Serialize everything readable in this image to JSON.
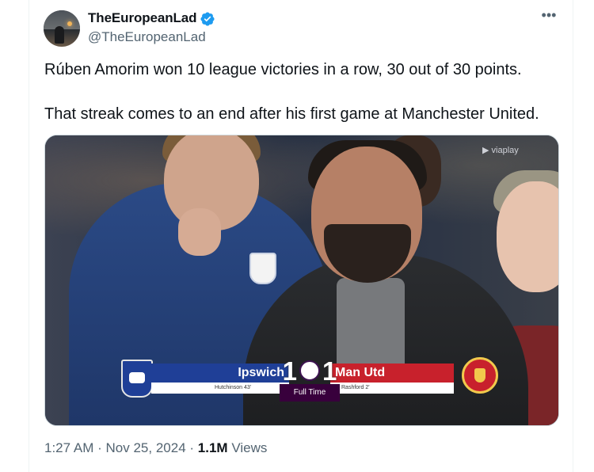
{
  "author": {
    "display_name": "TheEuropeanLad",
    "handle": "@TheEuropeanLad",
    "verified": true,
    "verified_color": "#1d9bf0"
  },
  "more_icon": "more-horizontal-icon",
  "tweet": {
    "line1": "Rúben Amorim won 10 league victories in a row, 30 out of 30 points.",
    "line2": "That streak comes to an end after his first game at Manchester United."
  },
  "media": {
    "watermark": "viaplay",
    "scoreboard": {
      "home_team": "Ipswich",
      "away_team": "Man Utd",
      "home_score": "1",
      "away_score": "1",
      "status": "Full Time",
      "home_scorer": "Hutchinson 43'",
      "away_scorer": "Rashford 2'",
      "home_color": "#1f3f97",
      "away_color": "#c8212c",
      "league_color": "#38003c"
    }
  },
  "meta": {
    "time": "1:27 AM",
    "separator": "·",
    "date": "Nov 25, 2024",
    "views_count": "1.1M",
    "views_label": "Views"
  }
}
